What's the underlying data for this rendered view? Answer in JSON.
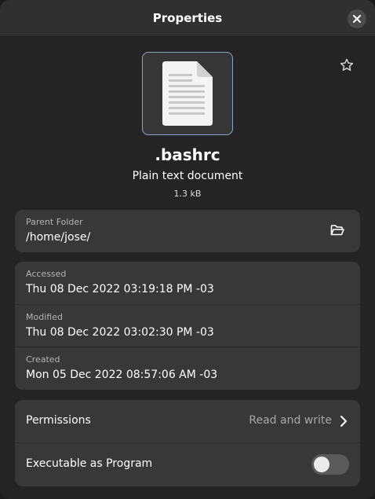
{
  "header": {
    "title": "Properties"
  },
  "file": {
    "name": ".bashrc",
    "type": "Plain text document",
    "size": "1.3 kB"
  },
  "parent": {
    "label": "Parent Folder",
    "path": "/home/jose/"
  },
  "times": [
    {
      "label": "Accessed",
      "value": "Thu 08 Dec 2022 03:19:18 PM -03"
    },
    {
      "label": "Modified",
      "value": "Thu 08 Dec 2022 03:02:30 PM -03"
    },
    {
      "label": "Created",
      "value": "Mon 05 Dec 2022 08:57:06 AM -03"
    }
  ],
  "permissions": {
    "label": "Permissions",
    "value": "Read and write"
  },
  "executable": {
    "label": "Executable as Program",
    "enabled": false
  },
  "icons": {
    "close": "close-icon",
    "star": "star-icon",
    "file": "text-document-icon",
    "open_folder": "open-folder-icon",
    "chevron": "chevron-right-icon"
  },
  "colors": {
    "accent": "#3584e4",
    "window_bg": "#242424",
    "card_bg": "#383838"
  }
}
